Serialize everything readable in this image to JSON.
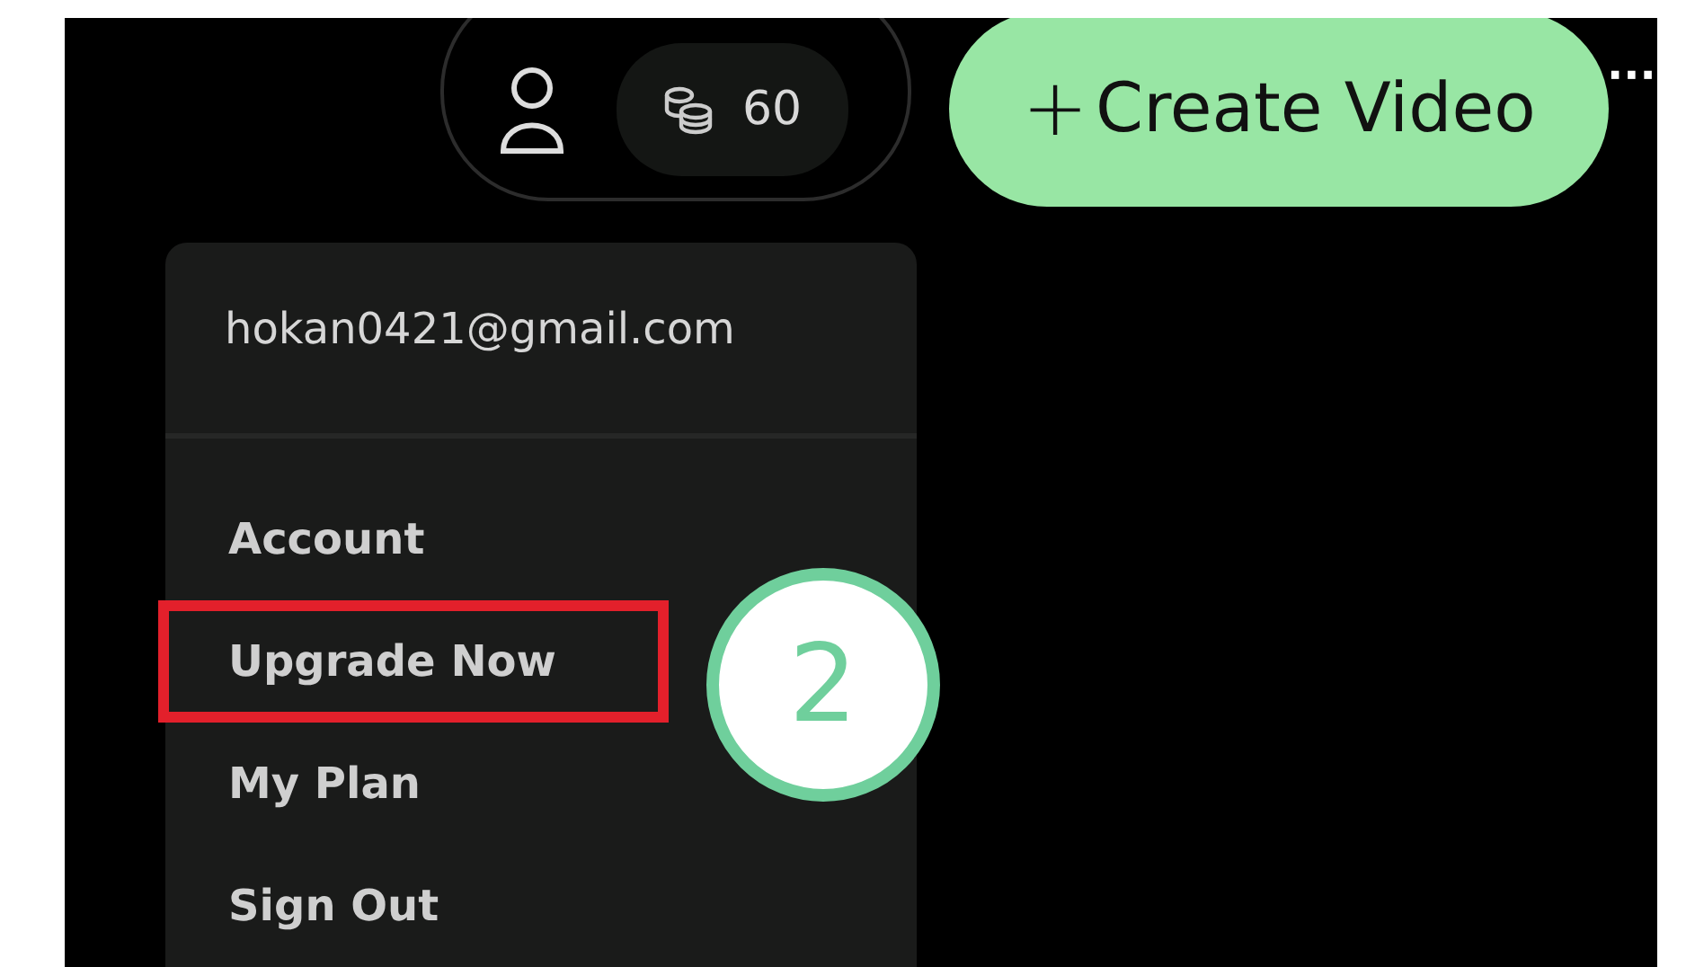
{
  "header": {
    "credits": "60",
    "create_button": {
      "icon": "+",
      "label": "Create Video"
    },
    "more": "···"
  },
  "account_menu": {
    "email": "hokan0421@gmail.com",
    "items": [
      {
        "label": "Account",
        "highlighted": false
      },
      {
        "label": "Upgrade Now",
        "highlighted": true
      },
      {
        "label": "My Plan",
        "highlighted": false
      },
      {
        "label": "Sign Out",
        "highlighted": false
      }
    ]
  },
  "annotation": {
    "step": "2"
  }
}
